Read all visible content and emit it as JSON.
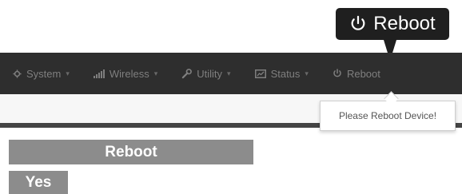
{
  "callout": {
    "label": "Reboot",
    "icon": "power-icon"
  },
  "nav": {
    "items": [
      {
        "label": "System",
        "icon": "gear-icon"
      },
      {
        "label": "Wireless",
        "icon": "signal-icon"
      },
      {
        "label": "Utility",
        "icon": "wrench-icon"
      },
      {
        "label": "Status",
        "icon": "monitor-icon"
      },
      {
        "label": "Reboot",
        "icon": "power-icon"
      }
    ]
  },
  "tooltip": {
    "text": "Please Reboot Device!"
  },
  "buttons": {
    "reboot_label": "Reboot",
    "yes_label": "Yes"
  },
  "colors": {
    "navbar_bg": "#2e2e2e",
    "nav_text": "#7f7f7f",
    "callout_bg": "#1f1f1f",
    "button_bg": "#8c8c8c"
  }
}
